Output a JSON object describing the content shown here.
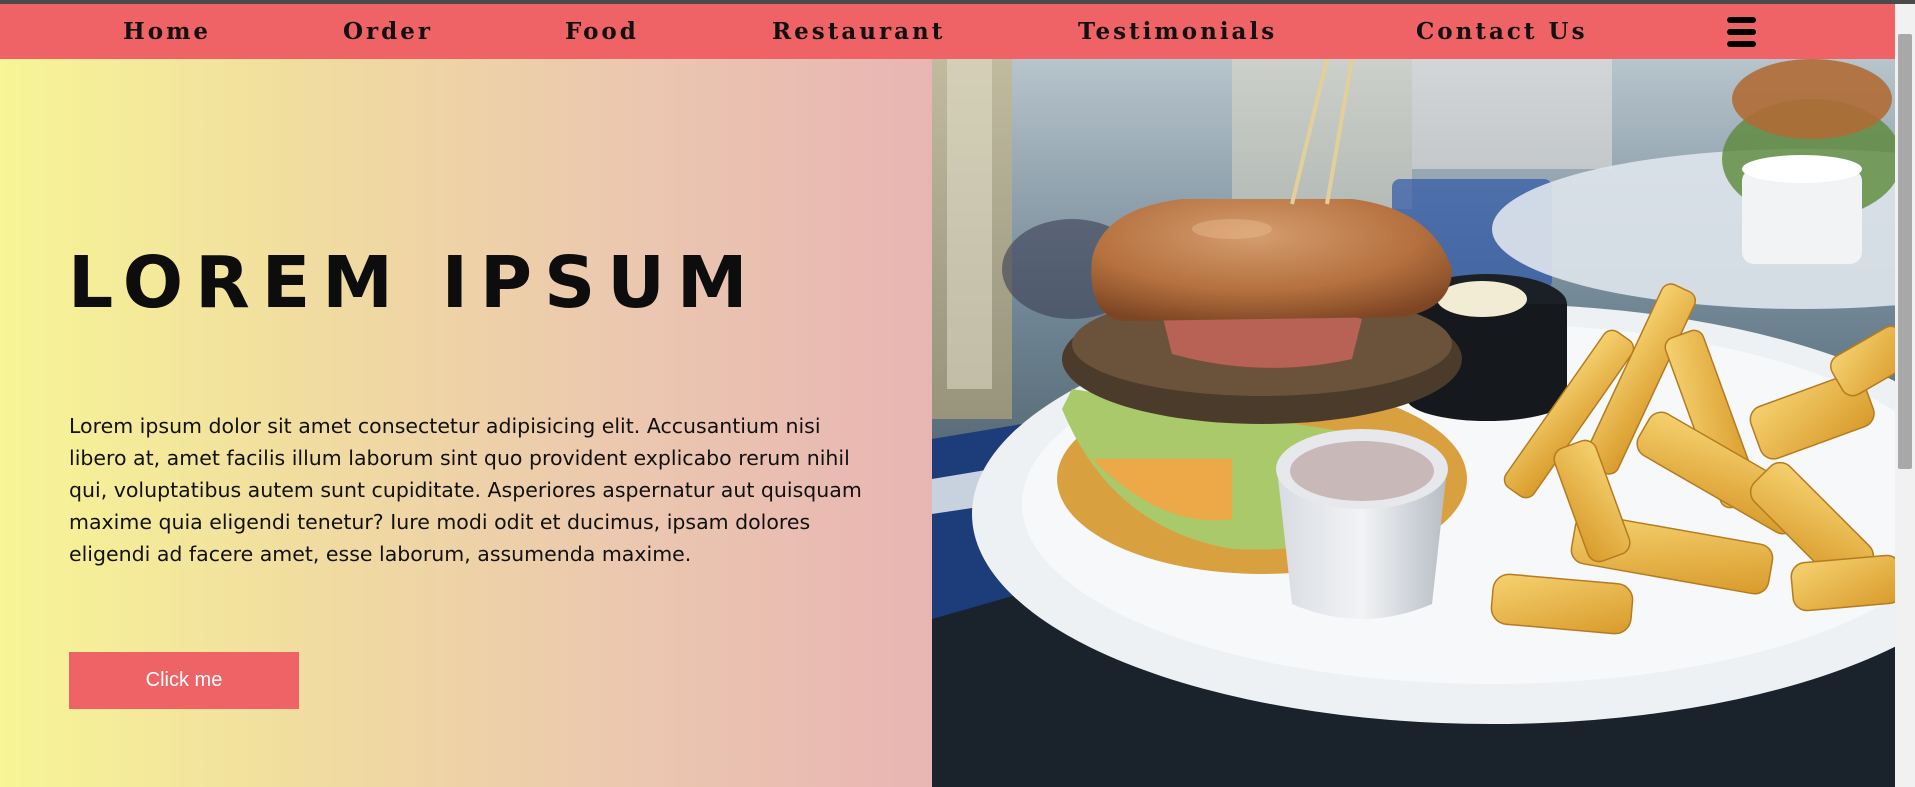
{
  "nav": {
    "items": [
      {
        "label": "Home"
      },
      {
        "label": "Order"
      },
      {
        "label": "Food"
      },
      {
        "label": "Restaurant"
      },
      {
        "label": "Testimonials"
      },
      {
        "label": "Contact Us"
      }
    ],
    "menu_icon": "hamburger-menu-icon"
  },
  "hero": {
    "title": "LOREM IPSUM",
    "text": "Lorem ipsum dolor sit amet consectetur adipisicing elit. Accusantium nisi libero at, amet facilis illum laborum sint quo provident explicabo rerum nihil qui, voluptatibus autem sunt cupiditate. Asperiores aspernatur aut quisquam maxime quia eligendi tenetur? Iure modi odit et ducimus, ipsam dolores eligendi ad facere amet, esse laborum, assumenda maxime.",
    "button_label": "Click me",
    "image": "burger-and-fries-photo"
  },
  "colors": {
    "accent": "#ef6366",
    "gradient_start": "#f7f596",
    "gradient_end": "#e8b5b3"
  }
}
